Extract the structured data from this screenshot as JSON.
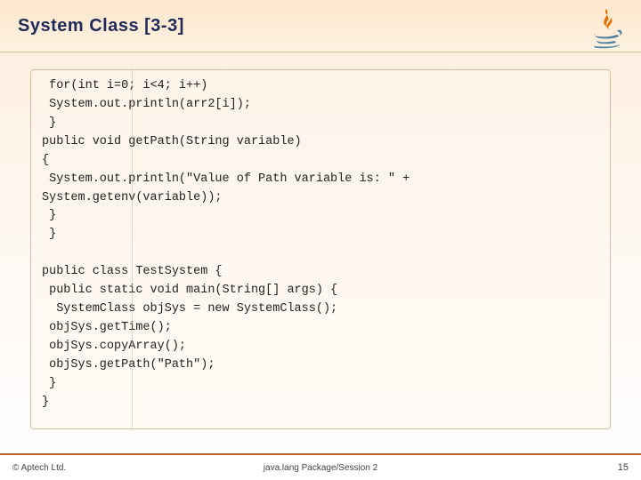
{
  "header": {
    "title": "System Class [3-3]",
    "logo_name": "java-logo"
  },
  "code": {
    "lines": [
      " for(int i=0; i<4; i++)",
      " System.out.println(arr2[i]);",
      " }",
      "public void getPath(String variable)",
      "{",
      " System.out.println(\"Value of Path variable is: \" +",
      "System.getenv(variable));",
      " }",
      " }",
      "",
      "public class TestSystem {",
      " public static void main(String[] args) {",
      "  SystemClass objSys = new SystemClass();",
      " objSys.getTime();",
      " objSys.copyArray();",
      " objSys.getPath(\"Path\");",
      " }",
      "}"
    ]
  },
  "footer": {
    "left": "© Aptech Ltd.",
    "center": "java.lang Package/Session 2",
    "page": "15"
  }
}
